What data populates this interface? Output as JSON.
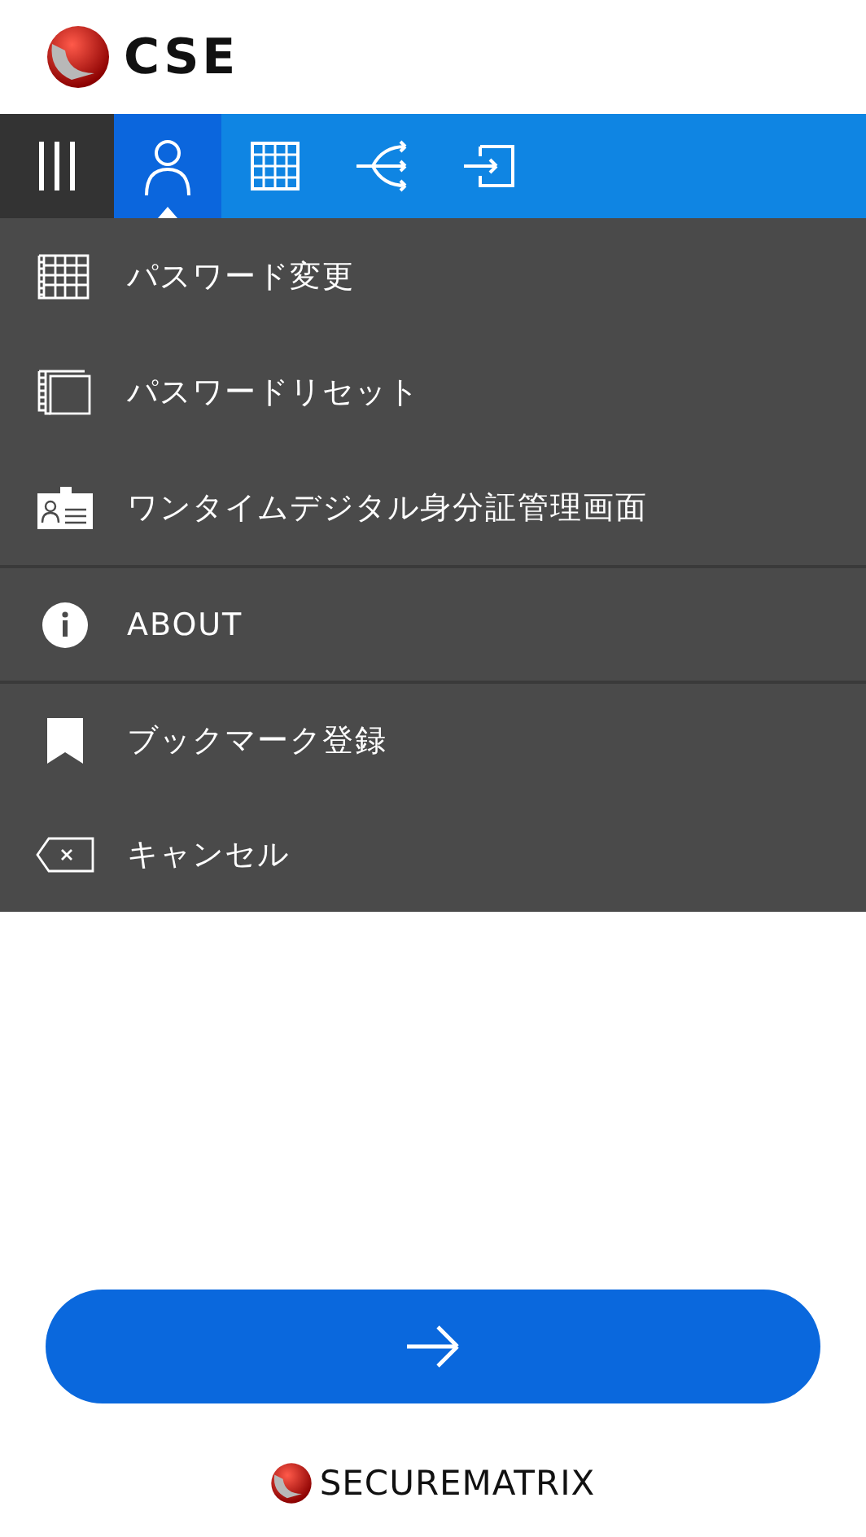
{
  "header": {
    "logo_text": "CSE"
  },
  "nav": {
    "tabs": [
      {
        "kind": "person",
        "selected": true
      },
      {
        "kind": "grid",
        "selected": false
      },
      {
        "kind": "split",
        "selected": false
      },
      {
        "kind": "enter",
        "selected": false
      }
    ]
  },
  "menu": {
    "items": [
      {
        "kind": "grid-doc",
        "label": "パスワード変更",
        "separated": false
      },
      {
        "kind": "blank-doc",
        "label": "パスワードリセット",
        "separated": false
      },
      {
        "kind": "id-card",
        "label": "ワンタイムデジタル身分証管理画面",
        "separated": false
      },
      {
        "kind": "info",
        "label": "ABOUT",
        "separated": true
      },
      {
        "kind": "bookmark",
        "label": "ブックマーク登録",
        "separated": true
      },
      {
        "kind": "cancel",
        "label": "キャンセル",
        "separated": false
      }
    ]
  },
  "footer": {
    "logo_text": "SECUREMATRIX"
  }
}
